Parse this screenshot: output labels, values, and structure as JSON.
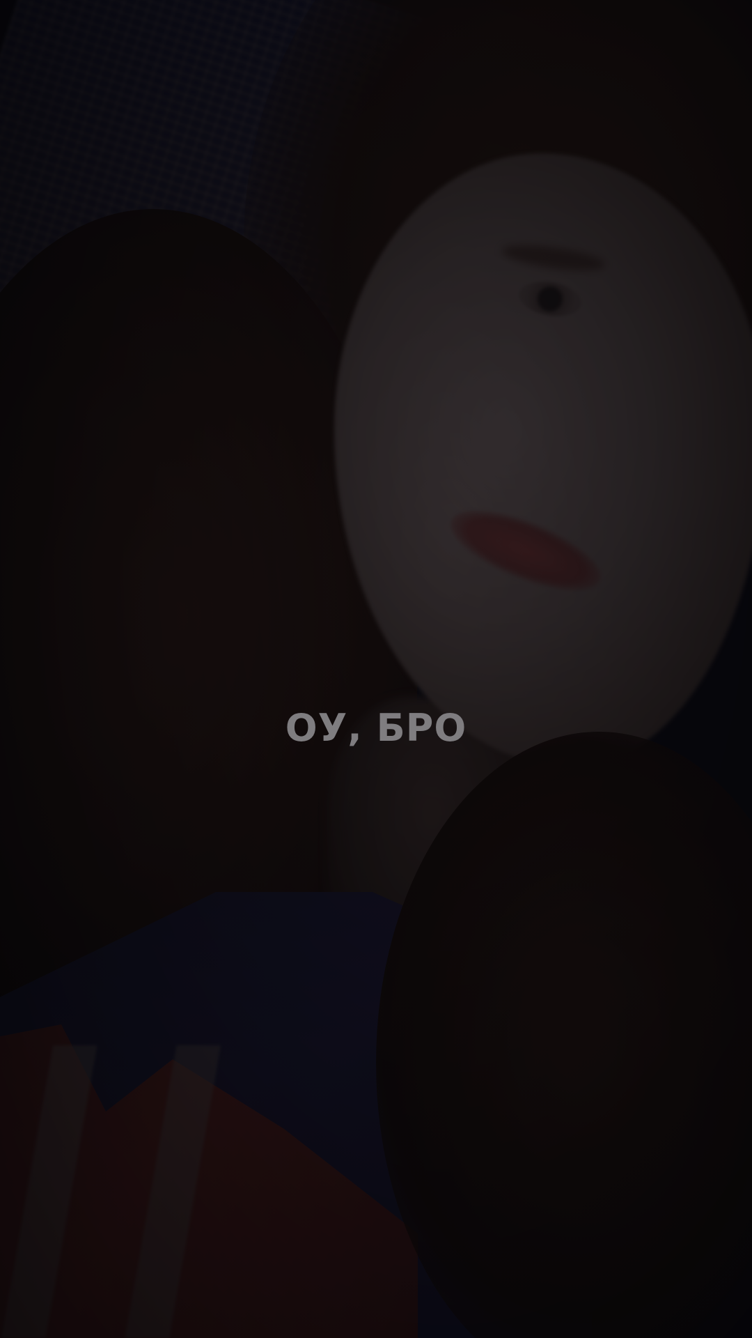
{
  "story": {
    "caption": "ОУ, БРО"
  },
  "colors": {
    "caption": "#7f7d80",
    "overlay": "#0a080e"
  }
}
